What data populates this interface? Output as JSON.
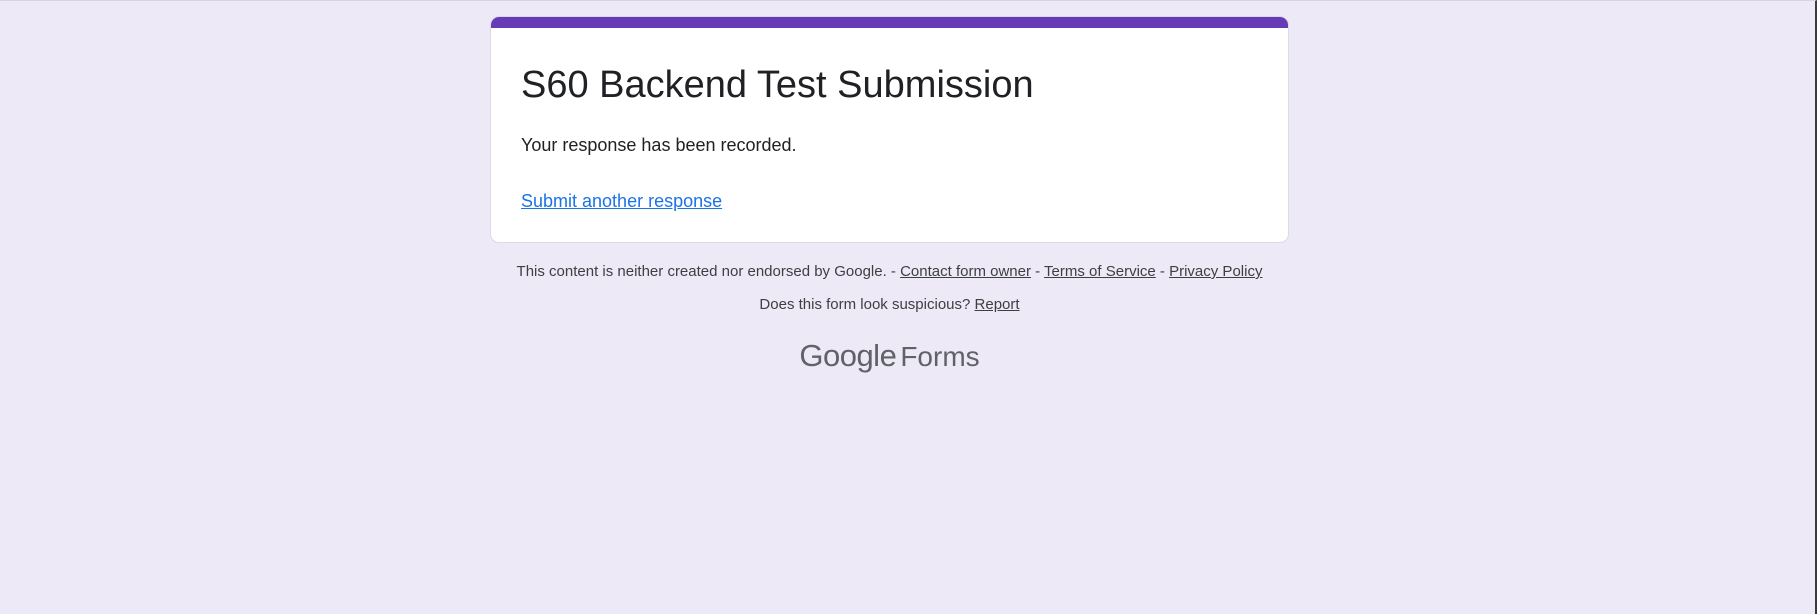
{
  "form": {
    "title": "S60 Backend Test Submission",
    "confirmation_message": "Your response has been recorded.",
    "submit_another_link": "Submit another response",
    "accent_color": "#673ab7",
    "background_color": "#eee9f6"
  },
  "footer": {
    "disclaimer": "This content is neither created nor endorsed by Google.",
    "separator": " - ",
    "contact_owner_link": "Contact form owner",
    "terms_link": "Terms of Service",
    "privacy_link": "Privacy Policy",
    "suspicious_prompt": "Does this form look suspicious?",
    "report_link": "Report"
  },
  "branding": {
    "company": "Google",
    "product": "Forms"
  }
}
